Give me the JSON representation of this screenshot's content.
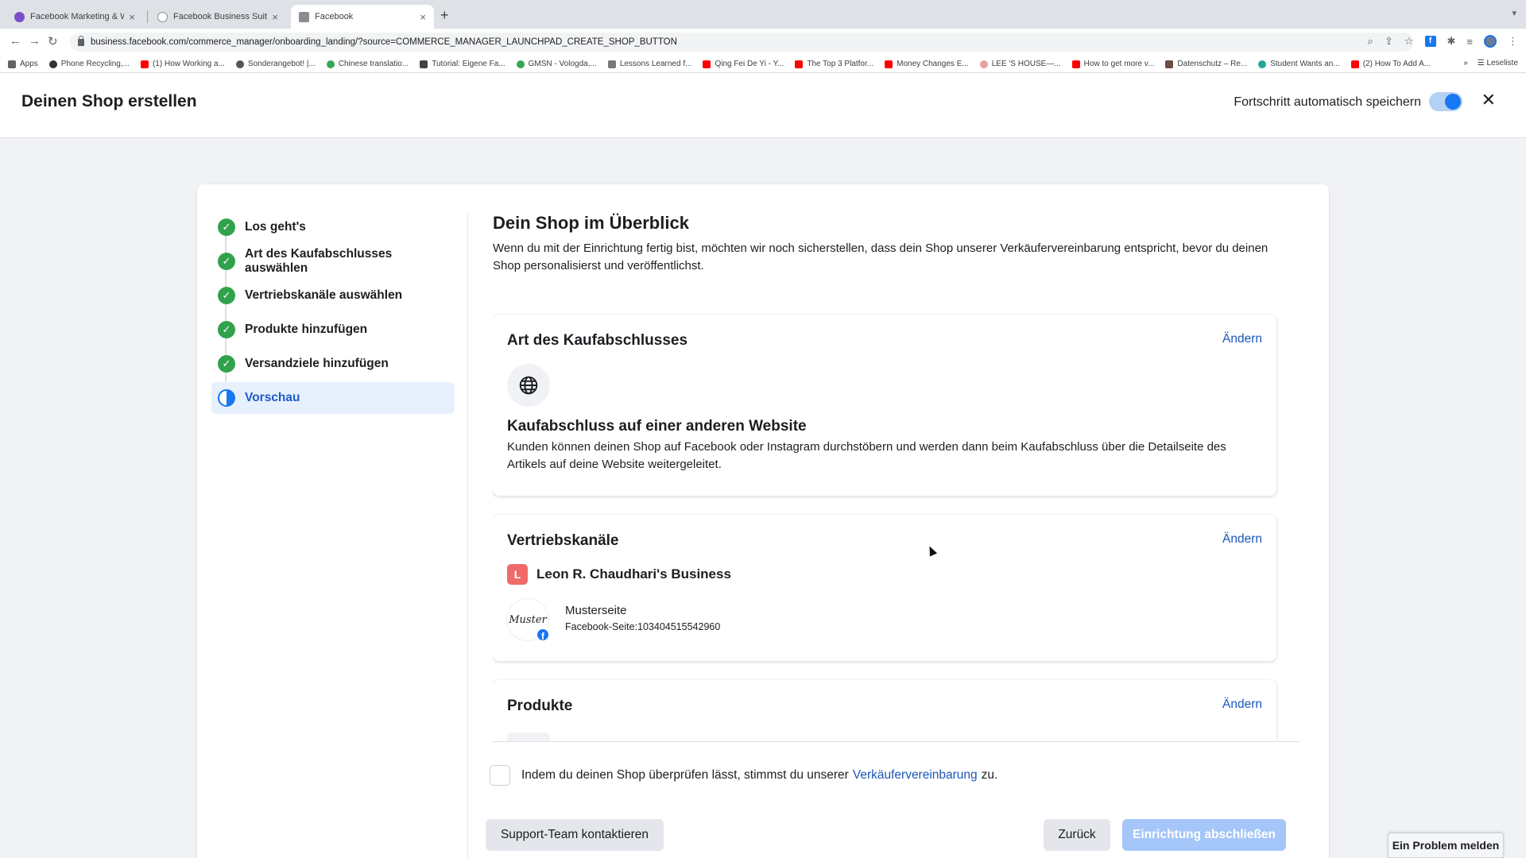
{
  "browser": {
    "tabs": [
      {
        "title": "Facebook Marketing & Werbe",
        "favicon_color": "#7b4fc9"
      },
      {
        "title": "Facebook Business Suite",
        "favicon_color": "#8a8d91"
      },
      {
        "title": "Facebook",
        "favicon_color": "#8a8d91"
      }
    ],
    "new_tab": "+",
    "url": "business.facebook.com/commerce_manager/onboarding_landing/?source=COMMERCE_MANAGER_LAUNCHPAD_CREATE_SHOP_BUTTON",
    "bookmarks": [
      {
        "label": "Apps",
        "color": "#5f6368"
      },
      {
        "label": "Phone Recycling,...",
        "color": "#333333"
      },
      {
        "label": "(1) How Working a...",
        "color": "#ff0000"
      },
      {
        "label": "Sonderangebot! |...",
        "color": "#555555"
      },
      {
        "label": "Chinese translatio...",
        "color": "#34a853"
      },
      {
        "label": "Tutorial: Eigene Fa...",
        "color": "#444444"
      },
      {
        "label": "GMSN - Vologda,...",
        "color": "#34a853"
      },
      {
        "label": "Lessons Learned f...",
        "color": "#777777"
      },
      {
        "label": "Qing Fei De Yi - Y...",
        "color": "#ff0000"
      },
      {
        "label": "The Top 3 Platfor...",
        "color": "#ff0000"
      },
      {
        "label": "Money Changes E...",
        "color": "#ff0000"
      },
      {
        "label": "LEE 'S HOUSE—...",
        "color": "#e8a0a0"
      },
      {
        "label": "How to get more v...",
        "color": "#ff0000"
      },
      {
        "label": "Datenschutz – Re...",
        "color": "#6d4c41"
      },
      {
        "label": "Student Wants an...",
        "color": "#26a69a"
      },
      {
        "label": "(2) How To Add A...",
        "color": "#ff0000"
      }
    ],
    "bookmarks_more": "»",
    "reading_list": "Leseliste"
  },
  "header": {
    "title": "Deinen Shop erstellen",
    "autosave_label": "Fortschritt automatisch speichern",
    "autosave_on": true
  },
  "steps": [
    {
      "label": "Los geht's",
      "status": "done"
    },
    {
      "label": "Art des Kaufabschlusses auswählen",
      "status": "done"
    },
    {
      "label": "Vertriebskanäle auswählen",
      "status": "done"
    },
    {
      "label": "Produkte hinzufügen",
      "status": "done"
    },
    {
      "label": "Versandziele hinzufügen",
      "status": "done"
    },
    {
      "label": "Vorschau",
      "status": "active"
    }
  ],
  "overview": {
    "title": "Dein Shop im Überblick",
    "description": "Wenn du mit der Einrichtung fertig bist, möchten wir noch sicherstellen, dass dein Shop unserer Verkäufervereinbarung entspricht, bevor du deinen Shop personalisierst und veröffentlichst."
  },
  "checkout": {
    "title": "Art des Kaufabschlusses",
    "edit": "Ändern",
    "method_title": "Kaufabschluss auf einer anderen Website",
    "method_desc": "Kunden können deinen Shop auf Facebook oder Instagram durchstöbern und werden dann beim Kaufabschluss über die Detailseite des Artikels auf deine Website weitergeleitet."
  },
  "channels": {
    "title": "Vertriebskanäle",
    "edit": "Ändern",
    "business_initial": "L",
    "business_name": "Leon R. Chaudhari's Business",
    "page_logo_text": "Muster",
    "page_name": "Musterseite",
    "page_id": "Facebook-Seite:103404515542960"
  },
  "products": {
    "title": "Produkte",
    "edit": "Ändern"
  },
  "agreement": {
    "before": "Indem du deinen Shop überprüfen lässt, stimmst du unserer",
    "link": "Verkäufervereinbarung",
    "after": "zu."
  },
  "buttons": {
    "support": "Support-Team kontaktieren",
    "back": "Zurück",
    "finish": "Einrichtung abschließen"
  },
  "report_problem": "Ein Problem melden"
}
